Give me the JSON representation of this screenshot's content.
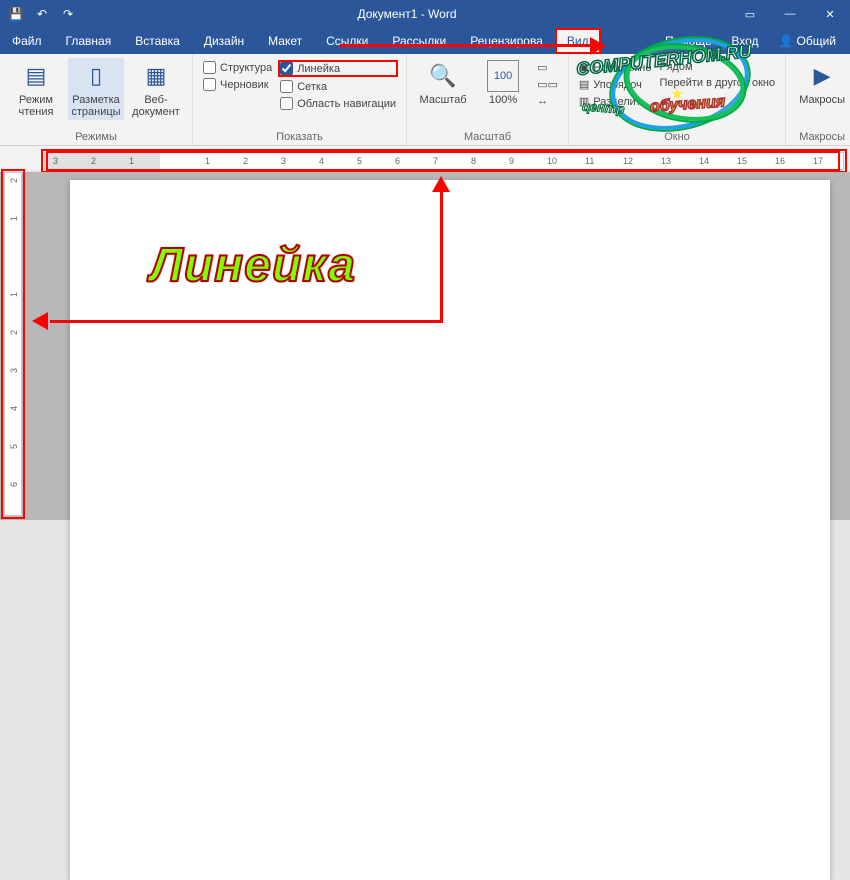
{
  "titlebar": {
    "save_icon": "💾",
    "undo_icon": "↶",
    "redo_icon": "↷",
    "title": "Документ1 - Word",
    "ribbon_opts_icon": "▭",
    "minimize": "—",
    "close": "✕"
  },
  "tabs": {
    "file": "Файл",
    "home": "Главная",
    "insert": "Вставка",
    "design": "Дизайн",
    "layout": "Макет",
    "references": "Ссылки",
    "mailings": "Рассылки",
    "review": "Рецензирова",
    "view": "Вид",
    "help": "Помощь",
    "signin": "Вход",
    "share": "Общий"
  },
  "ribbon": {
    "modes": {
      "read": "Режим чтения",
      "print": "Разметка страницы",
      "web": "Веб-документ",
      "label": "Режимы"
    },
    "show": {
      "outline": "Структура",
      "draft": "Черновик",
      "ruler": "Линейка",
      "gridlines": "Сетка",
      "navpane": "Область навигации",
      "label": "Показать"
    },
    "zoom": {
      "zoom": "Масштаб",
      "hundred": "100%",
      "label": "Масштаб"
    },
    "window": {
      "new": "Новое окно",
      "arrange": "Упорядоч",
      "split": "Разделить",
      "switch1": "Рядом",
      "switch2": "Перейти в другое окно",
      "label": "Окно"
    },
    "macros": {
      "btn": "Макросы",
      "label": "Макросы"
    }
  },
  "ruler": {
    "h_numbers": [
      "3",
      "2",
      "1",
      "",
      "1",
      "2",
      "3",
      "4",
      "5",
      "6",
      "7",
      "8",
      "9",
      "10",
      "11",
      "12",
      "13",
      "14",
      "15",
      "16",
      "17"
    ],
    "v_numbers": [
      "2",
      "1",
      "",
      "1",
      "2",
      "3",
      "4",
      "5",
      "6"
    ]
  },
  "annotation": {
    "big_word": "Линейка"
  },
  "watermark": {
    "line1": "COMPUTERHOM.RU",
    "line2": "обучения",
    "line3": "центр"
  }
}
